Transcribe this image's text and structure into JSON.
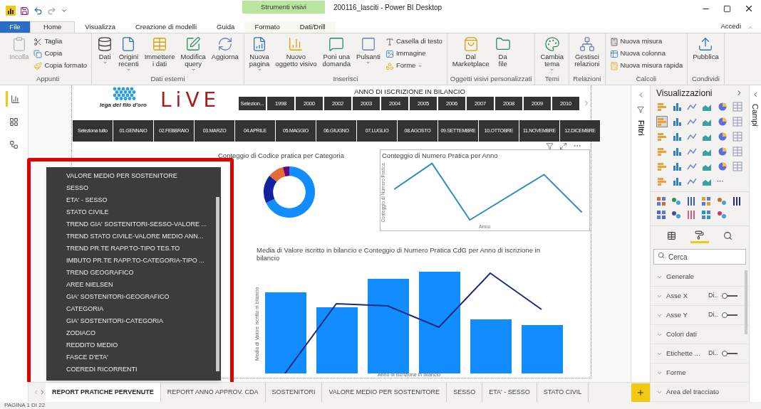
{
  "window": {
    "title": "200116_lasciti - Power BI Desktop",
    "context_tab_group": "Strumenti visivi",
    "sign_in": "Accedi"
  },
  "ribbon_tabs": [
    {
      "label": "File",
      "kind": "file",
      "selected": false
    },
    {
      "label": "Home",
      "kind": "tab",
      "selected": true
    },
    {
      "label": "Visualizza",
      "kind": "tab",
      "selected": false
    },
    {
      "label": "Creazione di modelli",
      "kind": "tab",
      "selected": false
    },
    {
      "label": "Guida",
      "kind": "tab",
      "selected": false
    },
    {
      "label": "Formato",
      "kind": "context",
      "selected": false
    },
    {
      "label": "Dati/Drill",
      "kind": "context",
      "selected": false
    }
  ],
  "ribbon_groups": [
    {
      "label": "Appunti",
      "buttons": [
        {
          "label": "Incolla",
          "kind": "large",
          "disabled": true,
          "dropdown": false
        },
        {
          "label": "Taglia",
          "kind": "small",
          "disabled": false,
          "dropdown": false
        },
        {
          "label": "Copia",
          "kind": "small",
          "disabled": false,
          "dropdown": false
        },
        {
          "label": "Copia formato",
          "kind": "small",
          "disabled": false,
          "dropdown": false
        }
      ]
    },
    {
      "label": "Dati esterni",
      "buttons": [
        {
          "label": "Dati",
          "kind": "large",
          "disabled": false,
          "dropdown": true
        },
        {
          "label": "Origini\nrecenti",
          "kind": "large",
          "disabled": false,
          "dropdown": true
        },
        {
          "label": "Immettere\ni dati",
          "kind": "large",
          "disabled": false,
          "dropdown": false
        },
        {
          "label": "Modifica\nquery",
          "kind": "large",
          "disabled": false,
          "dropdown": true
        },
        {
          "label": "Aggiorna",
          "kind": "large",
          "disabled": false,
          "dropdown": false
        }
      ]
    },
    {
      "label": "Inserisci",
      "buttons": [
        {
          "label": "Nuova\npagina",
          "kind": "large",
          "disabled": false,
          "dropdown": true
        },
        {
          "label": "Nuovo\noggetto visivo",
          "kind": "large",
          "disabled": false,
          "dropdown": false
        },
        {
          "label": "Poni una\ndomanda",
          "kind": "large",
          "disabled": false,
          "dropdown": false
        },
        {
          "label": "Pulsanti",
          "kind": "large",
          "disabled": false,
          "dropdown": true
        },
        {
          "label": "Casella di testo",
          "kind": "small",
          "disabled": false,
          "dropdown": false
        },
        {
          "label": "Immagine",
          "kind": "small",
          "disabled": false,
          "dropdown": false
        },
        {
          "label": "Forme",
          "kind": "small",
          "disabled": false,
          "dropdown": true
        }
      ]
    },
    {
      "label": "Oggetti visivi personalizzati",
      "buttons": [
        {
          "label": "Dal\nMarketplace",
          "kind": "large",
          "disabled": false,
          "dropdown": false
        },
        {
          "label": "Da\nfile",
          "kind": "large",
          "disabled": false,
          "dropdown": false
        }
      ]
    },
    {
      "label": "Temi",
      "buttons": [
        {
          "label": "Cambia\ntema",
          "kind": "large",
          "disabled": false,
          "dropdown": true
        }
      ]
    },
    {
      "label": "Relazioni",
      "buttons": [
        {
          "label": "Gestisci\nrelazioni",
          "kind": "large",
          "disabled": false,
          "dropdown": false
        }
      ]
    },
    {
      "label": "Calcoli",
      "buttons": [
        {
          "label": "Nuova misura",
          "kind": "small",
          "disabled": false,
          "dropdown": false
        },
        {
          "label": "Nuova colonna",
          "kind": "small",
          "disabled": false,
          "dropdown": false
        },
        {
          "label": "Nuova misura rapida",
          "kind": "small",
          "disabled": false,
          "dropdown": false
        }
      ]
    },
    {
      "label": "Condividi",
      "buttons": [
        {
          "label": "Pubblica",
          "kind": "large",
          "disabled": false,
          "dropdown": false
        }
      ]
    }
  ],
  "views": [
    {
      "selected": true
    },
    {
      "selected": false
    },
    {
      "selected": false
    }
  ],
  "report": {
    "logos": {
      "lega": "lega del filo d'oro",
      "live": "LiVE"
    },
    "year_slicer": {
      "title": "ANNO DI ISCRIZIONE IN BILANCIO",
      "items": [
        "Selezion...",
        "1998",
        "2000",
        "2002",
        "2003",
        "2004",
        "2005",
        "2006",
        "2007",
        "2008",
        "2009",
        "2010"
      ]
    },
    "month_slicer": {
      "items": [
        "Seleziona tutto",
        "01.GENNAIO",
        "02.FEBBRAIO",
        "03.MARZO",
        "04.APRILE",
        "05.MAGGIO",
        "06.GIUGNO",
        "07.LUGLIO",
        "08.AGOSTO",
        "09.SETTEMBRE",
        "10.OTTOBRE",
        "11.NOVEMBRE",
        "12.DICEMBRE"
      ]
    },
    "donut": {
      "title": "Conteggio di Codice pratica per Categoria"
    },
    "line_chart": {
      "title": "Conteggio di Numero Pratica per Anno",
      "ylabel": "Conteggio di Numero Pratica",
      "xlabel": "Anno"
    },
    "combo_chart": {
      "title": "Media di Valore iscritto in bilancio e Conteggio di Numero Pratica CdG per Anno di iscrizione in bilancio",
      "ylabel": "Media di Valore iscritto in bilancio",
      "xlabel": "Anno di iscrizione in bilancio"
    }
  },
  "page_menu": [
    "VALORE MEDIO PER SOSTENITORE",
    "SESSO",
    "ETA' - SESSO",
    "STATO CIVILE",
    "TREND GIA' SOSTENITORI-SESSO-VALORE ...",
    "TREND STATO CIVILE-VALORE MEDIO ANN...",
    "TREND PR.TE RAPP.TO-TIPO TES.TO",
    "IMBUTO PR.TE RAPP.TO-CATEGORIA-TIPO ...",
    "TREND GEOGRAFICO",
    "AREE NIELSEN",
    "GIA' SOSTENITORI-GEOGRAFICO",
    "CATEGORIA",
    "GIA' SOSTENITORI-CATEGORIA",
    "ZODIACO",
    "REDDITO MEDIO",
    "FASCE D'ETA'",
    "COEREDI RICORRENTI"
  ],
  "page_tabs": [
    {
      "label": "REPORT PRATICHE PERVENUTE",
      "selected": true
    },
    {
      "label": "REPORT ANNO APPROV. CDA",
      "selected": false
    },
    {
      "label": "SOSTENITORI",
      "selected": false
    },
    {
      "label": "VALORE MEDIO PER SOSTENITORE",
      "selected": false
    },
    {
      "label": "SESSO",
      "selected": false
    },
    {
      "label": "ETA' - SESSO",
      "selected": false
    },
    {
      "label": "STATO CIVIL",
      "selected": false
    }
  ],
  "filters_pane": {
    "title": "Filtri"
  },
  "visualizations": {
    "title": "Visualizzazioni",
    "gallery": [
      {
        "selected": false
      },
      {
        "selected": false
      },
      {
        "selected": false
      },
      {
        "selected": false
      },
      {
        "selected": false
      },
      {
        "selected": false
      },
      {
        "selected": true
      },
      {
        "selected": false
      },
      {
        "selected": false
      },
      {
        "selected": false
      },
      {
        "selected": false
      },
      {
        "selected": false
      },
      {
        "selected": false
      },
      {
        "selected": false
      },
      {
        "selected": false
      },
      {
        "selected": false
      },
      {
        "selected": false
      },
      {
        "selected": false
      },
      {
        "selected": false
      },
      {
        "selected": false
      },
      {
        "selected": false
      },
      {
        "selected": false
      },
      {
        "selected": false
      },
      {
        "selected": false
      },
      {
        "selected": false
      },
      {
        "selected": false
      },
      {
        "selected": false
      },
      {
        "selected": false
      },
      {
        "selected": false
      },
      {
        "selected": false
      },
      {
        "selected": false
      },
      {
        "selected": false
      },
      {
        "selected": false
      },
      {
        "selected": false
      }
    ],
    "gallery_more": "···",
    "pane_tabs": [
      {
        "selected": false
      },
      {
        "selected": true
      },
      {
        "selected": false
      }
    ],
    "search": {
      "placeholder": "Cerca"
    },
    "sections": [
      {
        "label": "Generale"
      },
      {
        "label": "Asse X",
        "value": "Di..",
        "on": false
      },
      {
        "label": "Asse Y",
        "value": "Di..",
        "on": false
      },
      {
        "label": "Colori dati"
      },
      {
        "label": "Etichette ...",
        "value": "Di..",
        "on": false
      },
      {
        "label": "Forme"
      },
      {
        "label": "Area del tracciato"
      }
    ]
  },
  "fields_pane": {
    "title": "Campi"
  },
  "status_bar": "PAGINA 1 DI 22"
}
